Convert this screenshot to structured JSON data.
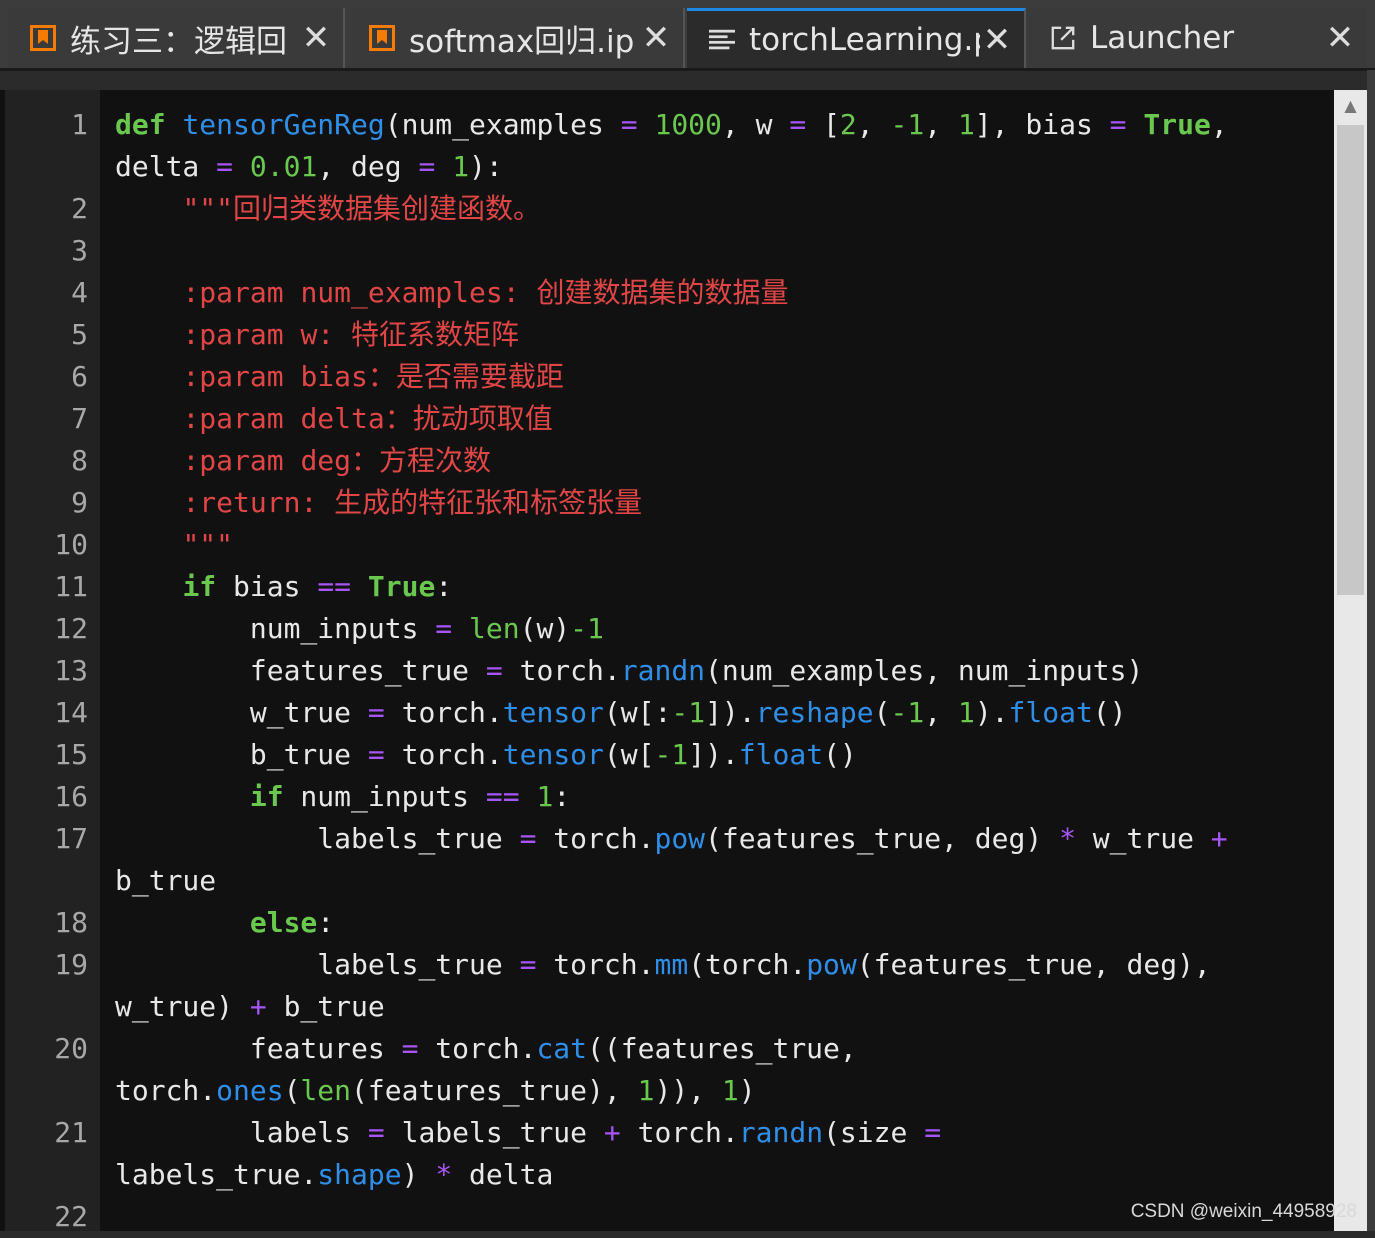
{
  "tabs": [
    {
      "label": "练习三：逻辑回",
      "icon": "notebook-icon"
    },
    {
      "label": "softmax回归.ip",
      "icon": "notebook-icon"
    },
    {
      "label": "torchLearning.p",
      "icon": "text-file-icon"
    },
    {
      "label": "Launcher",
      "icon": "launcher-icon"
    }
  ],
  "line_numbers": [
    "1",
    "2",
    "3",
    "4",
    "5",
    "6",
    "7",
    "8",
    "9",
    "10",
    "11",
    "12",
    "13",
    "14",
    "15",
    "16",
    "17",
    "18",
    "19",
    "20",
    "21",
    "22"
  ],
  "code": {
    "l1a": {
      "kw": "def",
      "fn": "tensorGenReg",
      "t1": "(num_examples ",
      "op1": "=",
      "n1": "1000",
      "t2": ", w ",
      "op2": "=",
      "t3": " [",
      "n2": "2",
      "t4": ", ",
      "n3": "-1",
      "t5": ", ",
      "n4": "1",
      "t6": "], bias ",
      "op3": "=",
      "kw2": "True",
      "t7": ","
    },
    "l1b": {
      "t1": "delta ",
      "op1": "=",
      "n1": "0.01",
      "t2": ", deg ",
      "op2": "=",
      "n2": "1",
      "t3": "):"
    },
    "l2": {
      "q": "\"\"\"",
      "s": "回归类数据集创建函数。"
    },
    "l4": {
      "a": ":param num_examples: ",
      "b": "创建数据集的数据量"
    },
    "l5": {
      "a": ":param w: ",
      "b": "特征系数矩阵"
    },
    "l6": {
      "a": ":param bias",
      "b": "：是否需要截距"
    },
    "l7": {
      "a": ":param delta",
      "b": "：扰动项取值"
    },
    "l8": {
      "a": ":param deg",
      "b": "：方程次数"
    },
    "l9": {
      "a": ":return: ",
      "b": "生成的特征张和标签张量"
    },
    "l10": {
      "q": "\"\"\""
    },
    "l11": {
      "kw": "if",
      "t1": " bias ",
      "op": "==",
      "kw2": "True",
      "t2": ":"
    },
    "l12": {
      "t1": "num_inputs ",
      "op": "=",
      "fn": "len",
      "t2": "(w)",
      "n": "-1"
    },
    "l13": {
      "t1": "features_true ",
      "op": "=",
      "t2": " torch.",
      "fn": "randn",
      "t3": "(num_examples, num_inputs)"
    },
    "l14": {
      "t1": "w_true ",
      "op": "=",
      "t2": " torch.",
      "fn": "tensor",
      "t3": "(w[:",
      "n1": "-1",
      "t4": "]).",
      "fn2": "reshape",
      "t5": "(",
      "n2": "-1",
      "t6": ", ",
      "n3": "1",
      "t7": ").",
      "fn3": "float",
      "t8": "()"
    },
    "l15": {
      "t1": "b_true ",
      "op": "=",
      "t2": " torch.",
      "fn": "tensor",
      "t3": "(w[",
      "n": "-1",
      "t4": "]).",
      "fn2": "float",
      "t5": "()"
    },
    "l16": {
      "kw": "if",
      "t1": " num_inputs ",
      "op": "==",
      "n": "1",
      "t2": ":"
    },
    "l17a": {
      "t1": "labels_true ",
      "op": "=",
      "t2": " torch.",
      "fn": "pow",
      "t3": "(features_true, deg) ",
      "op2": "*",
      "t4": " w_true ",
      "op3": "+"
    },
    "l17b": {
      "t": "b_true"
    },
    "l18": {
      "kw": "else",
      "t": ":"
    },
    "l19a": {
      "t1": "labels_true ",
      "op": "=",
      "t2": " torch.",
      "fn": "mm",
      "t3": "(torch.",
      "fn2": "pow",
      "t4": "(features_true, deg),"
    },
    "l19b": {
      "t1": "w_true) ",
      "op": "+",
      "t2": " b_true"
    },
    "l20a": {
      "t1": "features ",
      "op": "=",
      "t2": " torch.",
      "fn": "cat",
      "t3": "((features_true,"
    },
    "l20b": {
      "t1": "torch.",
      "fn": "ones",
      "t2": "(",
      "fn2": "len",
      "t3": "(features_true), ",
      "n1": "1",
      "t4": ")), ",
      "n2": "1",
      "t5": ")"
    },
    "l21a": {
      "t1": "labels ",
      "op": "=",
      "t2": " labels_true ",
      "op2": "+",
      "t3": " torch.",
      "fn": "randn",
      "t4": "(size ",
      "op3": "="
    },
    "l21b": {
      "t1": "labels_true.",
      "fn": "shape",
      "t2": ") ",
      "op": "*",
      "t3": " delta"
    }
  },
  "watermark": "CSDN @weixin_44958928",
  "colors": {
    "keyword": "#6ac84f",
    "function": "#2f8fe8",
    "operator": "#a855f7",
    "number": "#6ac84f",
    "string": "#e04646",
    "accent": "#1e88e5"
  }
}
